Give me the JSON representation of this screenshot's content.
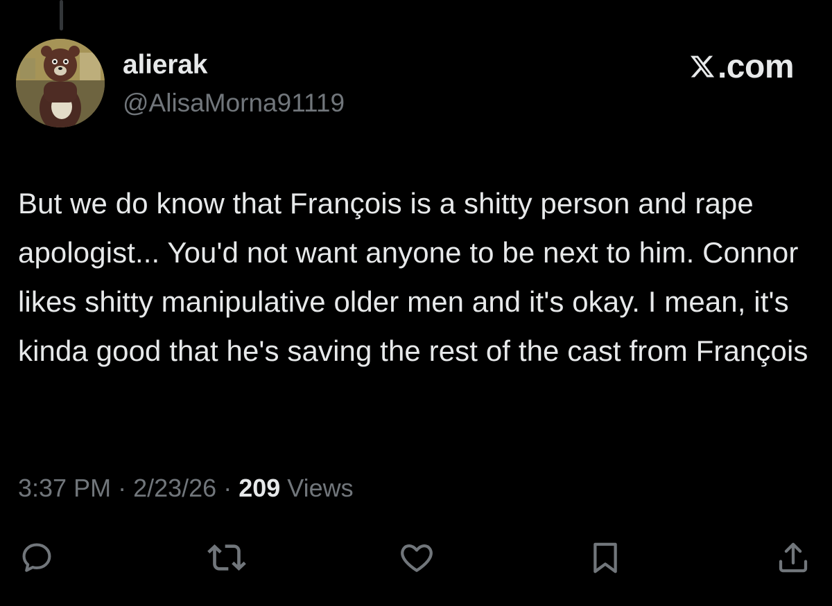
{
  "author": {
    "display_name": "alierak",
    "handle": "@AlisaMorna91119",
    "avatar_icon": "avatar-bear-costume"
  },
  "source": {
    "brand_icon": "x-logo-icon",
    "label": ".com"
  },
  "tweet": {
    "text": "But we do know that François is a shitty person and rape apologist... You'd not want anyone to be next to him. Connor likes shitty manipulative older men and it's okay. I mean, it's kinda good that he's saving the rest of the cast from François"
  },
  "meta": {
    "time": "3:37 PM",
    "separator": " · ",
    "date": "2/23/26",
    "views_count": "209",
    "views_label": "Views"
  },
  "actions": [
    {
      "name": "reply",
      "icon": "reply-icon"
    },
    {
      "name": "repost",
      "icon": "repost-icon"
    },
    {
      "name": "like",
      "icon": "heart-icon"
    },
    {
      "name": "bookmark",
      "icon": "bookmark-icon"
    },
    {
      "name": "share",
      "icon": "share-icon"
    }
  ],
  "colors": {
    "background": "#000000",
    "primary_text": "#e7e9ea",
    "secondary_text": "#71767b",
    "thread_line": "#333639"
  }
}
